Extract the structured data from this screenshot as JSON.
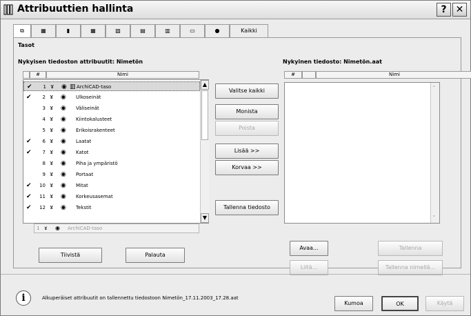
{
  "window": {
    "title": "Attribuuttien hallinta",
    "help_label": "?",
    "close_label": "✕"
  },
  "tabs": [
    {
      "name": "tab-layers",
      "label": "⧉"
    },
    {
      "name": "tab-pens",
      "label": "▦"
    },
    {
      "name": "tab-line-types",
      "label": "▮"
    },
    {
      "name": "tab-fills",
      "label": "▦"
    },
    {
      "name": "tab-composites",
      "label": "▧"
    },
    {
      "name": "tab-materials",
      "label": "▤"
    },
    {
      "name": "tab-zones",
      "label": "▥"
    },
    {
      "name": "tab-markup",
      "label": "▭"
    },
    {
      "name": "tab-profiles",
      "label": "●"
    },
    {
      "name": "tab-all",
      "label": "Kaikki"
    }
  ],
  "section_title": "Tasot",
  "left": {
    "heading": "Nykyisen tiedoston attribuutit: Nimetön",
    "col_num": "#",
    "col_name": "Nimi",
    "rows": [
      {
        "checked": "✔",
        "num": "1",
        "name": "ArchiCAD-taso"
      },
      {
        "checked": "✔",
        "num": "2",
        "name": "Ulkoseinät"
      },
      {
        "checked": "",
        "num": "3",
        "name": "Väliseinät"
      },
      {
        "checked": "",
        "num": "4",
        "name": "Kiintokalusteet"
      },
      {
        "checked": "",
        "num": "5",
        "name": "Erikoisrakenteet"
      },
      {
        "checked": "✔",
        "num": "6",
        "name": "Laatat"
      },
      {
        "checked": "✔",
        "num": "7",
        "name": "Katot"
      },
      {
        "checked": "",
        "num": "8",
        "name": "Piha ja ympäristö"
      },
      {
        "checked": "",
        "num": "9",
        "name": "Portaat"
      },
      {
        "checked": "✔",
        "num": "10",
        "name": "Mitat"
      },
      {
        "checked": "✔",
        "num": "11",
        "name": "Korkeusasemat"
      },
      {
        "checked": "✔",
        "num": "12",
        "name": "Tekstit"
      }
    ],
    "edit_num": "1",
    "edit_value": "ArchiCAD-taso",
    "compress_button": "Tiivistä",
    "restore_button": "Palauta"
  },
  "middle": {
    "select_all": "Valitse kaikki",
    "duplicate": "Monista",
    "delete": "Poista",
    "add": "Lisää >>",
    "replace": "Korvaa >>",
    "save_file": "Tallenna tiedosto"
  },
  "right": {
    "heading": "Nykyinen tiedosto: Nimetön.aat",
    "col_num": "#",
    "col_name": "Nimi",
    "open_button": "Avaa...",
    "save_button": "Tallenna",
    "append_button": "Liitä...",
    "save_as_button": "Tallenna nimellä..."
  },
  "footer": {
    "info_icon": "i",
    "message": "Alkuperäiset attribuutit on tallennettu tiedostoon Nimetön_17.11.2003_17.28.aat",
    "undo": "Kumoa",
    "ok": "OK",
    "apply": "Käytä"
  }
}
